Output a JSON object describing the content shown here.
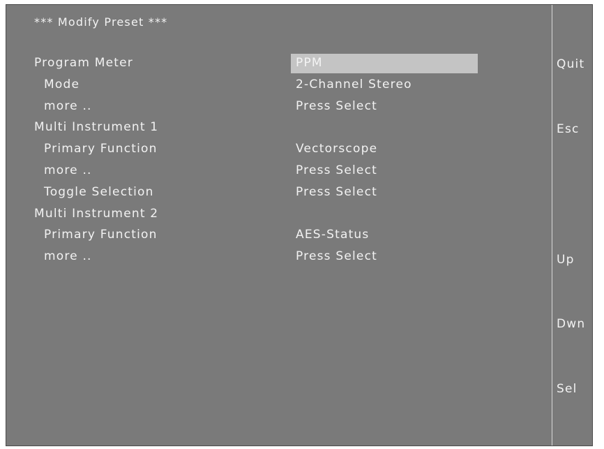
{
  "title": "*** Modify Preset ***",
  "rows": [
    {
      "label": "Program Meter",
      "value": "PPM",
      "indent": false,
      "selected": true
    },
    {
      "label": "Mode",
      "value": "2-Channel Stereo",
      "indent": true,
      "selected": false
    },
    {
      "label": "more ..",
      "value": "Press Select",
      "indent": true,
      "selected": false
    },
    {
      "label": "Multi Instrument 1",
      "value": "",
      "indent": false,
      "selected": false
    },
    {
      "label": "Primary Function",
      "value": "Vectorscope",
      "indent": true,
      "selected": false
    },
    {
      "label": "more ..",
      "value": "Press Select",
      "indent": true,
      "selected": false
    },
    {
      "label": "Toggle Selection",
      "value": "Press Select",
      "indent": true,
      "selected": false
    },
    {
      "label": "Multi Instrument 2",
      "value": "",
      "indent": false,
      "selected": false
    },
    {
      "label": "Primary Function",
      "value": "AES-Status",
      "indent": true,
      "selected": false
    },
    {
      "label": "more ..",
      "value": "Press Select",
      "indent": true,
      "selected": false
    }
  ],
  "softkeys": {
    "quit": "Quit",
    "esc": "Esc",
    "up": "Up",
    "down": "Dwn",
    "select": "Sel"
  },
  "colors": {
    "background": "#7a7a7a",
    "text": "#f2f2f2",
    "highlight": "#c4c4c4"
  }
}
